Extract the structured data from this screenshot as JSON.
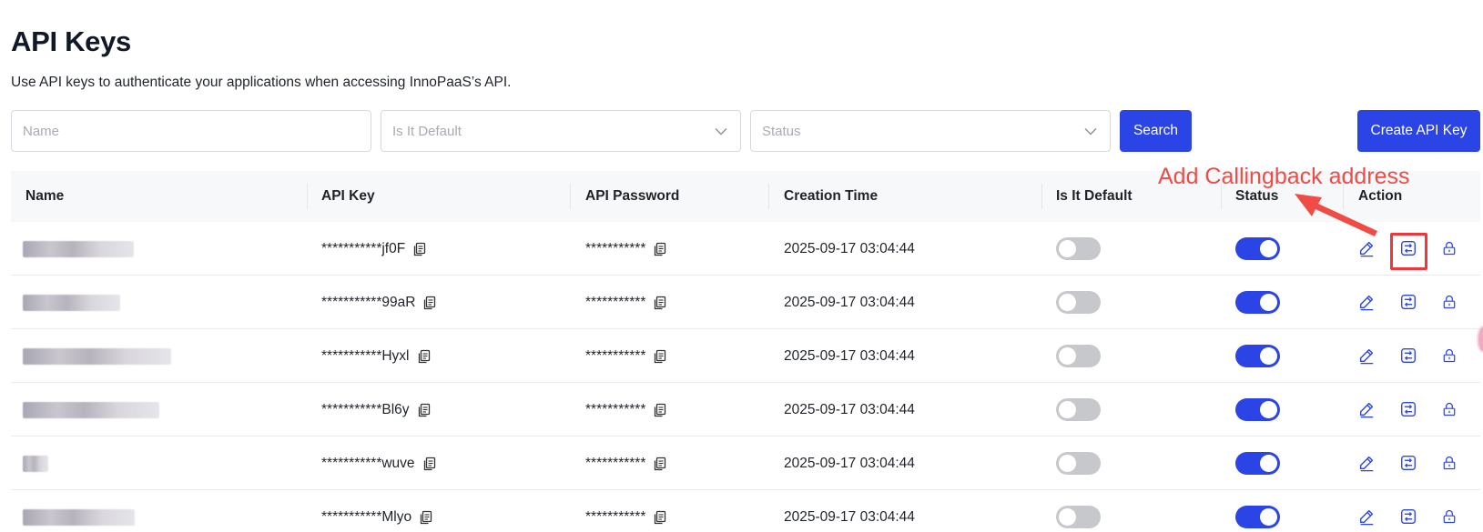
{
  "page": {
    "title": "API Keys",
    "subtitle": "Use API keys to authenticate your applications when accessing InnoPaaS’s API."
  },
  "filters": {
    "name_placeholder": "Name",
    "default_placeholder": "Is It Default",
    "status_placeholder": "Status",
    "search_label": "Search",
    "create_label": "Create API Key"
  },
  "table": {
    "headers": {
      "name": "Name",
      "api_key": "API Key",
      "api_password": "API Password",
      "creation_time": "Creation Time",
      "is_default": "Is It Default",
      "status": "Status",
      "action": "Action"
    },
    "rows": [
      {
        "api_key": "***********jf0F",
        "api_password": "***********",
        "creation_time": "2025-09-17 03:04:44",
        "is_default": false,
        "status": true
      },
      {
        "api_key": "***********99aR",
        "api_password": "***********",
        "creation_time": "2025-09-17 03:04:44",
        "is_default": false,
        "status": true
      },
      {
        "api_key": "***********Hyxl",
        "api_password": "***********",
        "creation_time": "2025-09-17 03:04:44",
        "is_default": false,
        "status": true
      },
      {
        "api_key": "***********Bl6y",
        "api_password": "***********",
        "creation_time": "2025-09-17 03:04:44",
        "is_default": false,
        "status": true
      },
      {
        "api_key": "***********wuve",
        "api_password": "***********",
        "creation_time": "2025-09-17 03:04:44",
        "is_default": false,
        "status": true
      },
      {
        "api_key": "***********Mlyo",
        "api_password": "***********",
        "creation_time": "2025-09-17 03:04:44",
        "is_default": false,
        "status": true
      }
    ]
  },
  "annotation": {
    "text": "Add Callingback address",
    "color": "#f04b45"
  },
  "theme": {
    "accent": "#2b44e6",
    "toggle_off": "#c6c8cc",
    "header_bg": "#f7f8fa"
  },
  "icons": {
    "copy": "copy-icon",
    "edit": "edit-pencil-icon",
    "callback": "callback-address-icon",
    "lock": "lock-icon",
    "chevron": "chevron-down-icon"
  }
}
